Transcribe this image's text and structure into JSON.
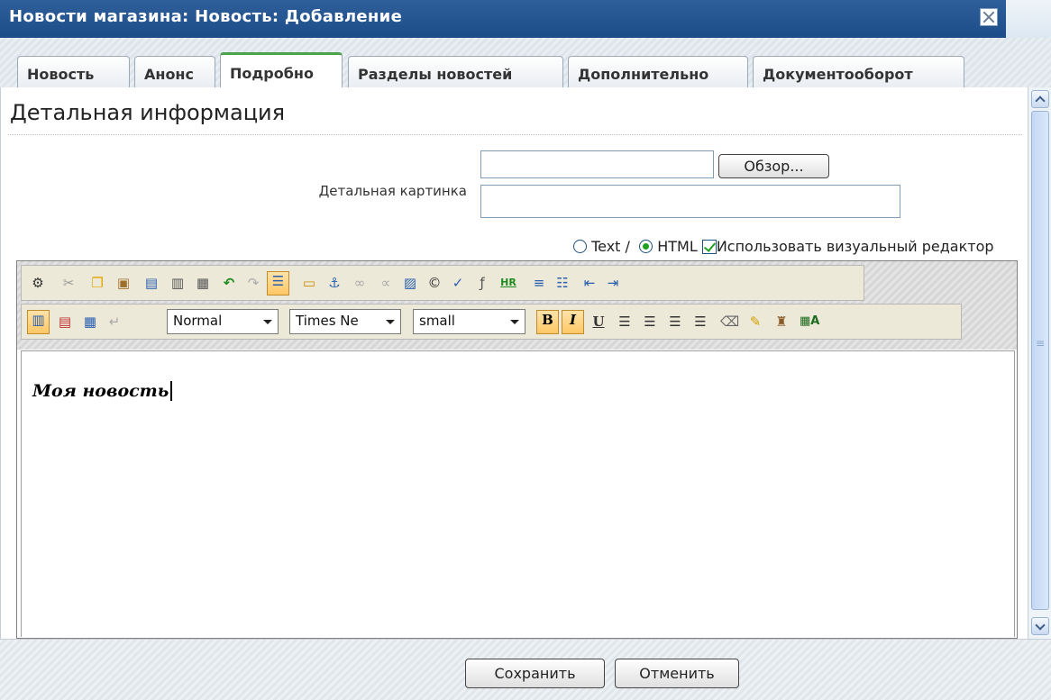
{
  "window": {
    "title": "Новости магазина: Новость: Добавление"
  },
  "tabs": [
    {
      "label": "Новость"
    },
    {
      "label": "Анонс"
    },
    {
      "label": "Подробно",
      "active": true
    },
    {
      "label": "Разделы новостей"
    },
    {
      "label": "Дополнительно"
    },
    {
      "label": "Документооборот"
    }
  ],
  "section": {
    "title": "Детальная информация"
  },
  "picture": {
    "label": "Детальная картинка",
    "browse_label": "Обзор...",
    "file_value": "",
    "description_value": ""
  },
  "mode": {
    "text_label": "Text /",
    "html_label": "HTML",
    "selected": "HTML",
    "visual_label": "Использовать визуальный редактор",
    "visual_checked": true
  },
  "toolbar": {
    "row1_icons": [
      "settings-icon",
      "cut-icon",
      "copy-icon",
      "paste-icon",
      "paste-word-icon",
      "paste-text-icon",
      "select-all-icon",
      "undo-icon",
      "redo-icon",
      "insert-row-icon",
      "insert-table-icon",
      "anchor-icon",
      "link-icon",
      "unlink-icon",
      "image-icon",
      "special-char-icon",
      "spellcheck-icon",
      "flash-icon",
      "horizontal-rule-icon",
      "ordered-list-icon",
      "unordered-list-icon",
      "outdent-icon",
      "indent-icon"
    ],
    "row2_icons": [
      "view-wysiwyg-icon",
      "view-source-icon",
      "view-split-icon",
      "line-break-icon"
    ],
    "format_value": "Normal",
    "font_value": "Times Ne",
    "size_value": "small",
    "format_icons": [
      "bold-icon",
      "italic-icon",
      "underline-icon",
      "align-left-icon",
      "align-center-icon",
      "align-right-icon",
      "align-justify-icon",
      "eraser-icon",
      "clean-icon",
      "text-color-icon",
      "bg-color-icon"
    ],
    "bold_pressed": false,
    "italic_pressed": true
  },
  "editor": {
    "content": "Моя новость"
  },
  "footer": {
    "save_label": "Сохранить",
    "cancel_label": "Отменить"
  },
  "colors": {
    "titlebar": "#1d4d88",
    "active_tab_accent": "#4aa34a",
    "pressed": "#ffc766"
  }
}
